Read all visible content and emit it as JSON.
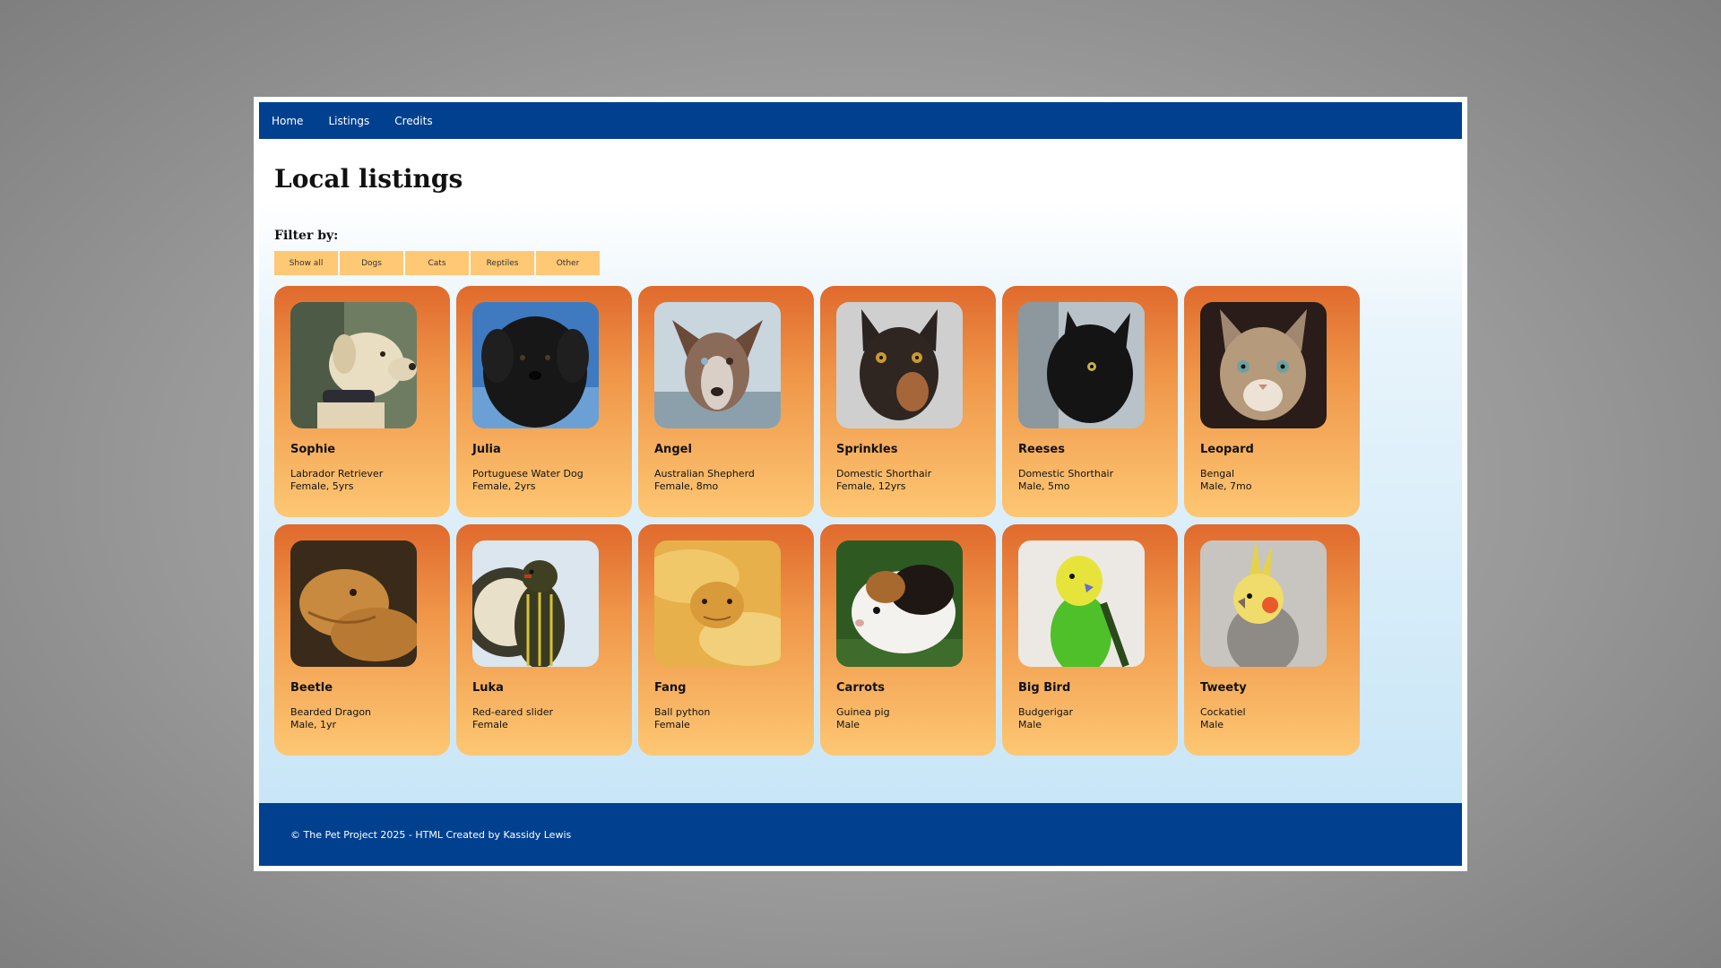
{
  "nav": {
    "items": [
      {
        "label": "Home"
      },
      {
        "label": "Listings"
      },
      {
        "label": "Credits"
      }
    ]
  },
  "page": {
    "title": "Local listings",
    "filter_label": "Filter by:"
  },
  "filters": [
    {
      "label": "Show all"
    },
    {
      "label": "Dogs"
    },
    {
      "label": "Cats"
    },
    {
      "label": "Reptiles"
    },
    {
      "label": "Other"
    }
  ],
  "pets": [
    {
      "name": "Sophie",
      "breed": "Labrador Retriever",
      "details": "Female, 5yrs",
      "photo": "dog-photo"
    },
    {
      "name": "Julia",
      "breed": "Portuguese Water Dog",
      "details": "Female, 2yrs",
      "photo": "dog-photo"
    },
    {
      "name": "Angel",
      "breed": "Australian Shepherd",
      "details": "Female, 8mo",
      "photo": "dog-photo"
    },
    {
      "name": "Sprinkles",
      "breed": "Domestic Shorthair",
      "details": "Female, 12yrs",
      "photo": "cat-photo"
    },
    {
      "name": "Reeses",
      "breed": "Domestic Shorthair",
      "details": "Male, 5mo",
      "photo": "cat-photo"
    },
    {
      "name": "Leopard",
      "breed": "Bengal",
      "details": "Male, 7mo",
      "photo": "cat-photo"
    },
    {
      "name": "Beetle",
      "breed": "Bearded Dragon",
      "details": "Male, 1yr",
      "photo": "lizard-photo"
    },
    {
      "name": "Luka",
      "breed": "Red-eared slider",
      "details": "Female",
      "photo": "turtle-photo"
    },
    {
      "name": "Fang",
      "breed": "Ball python",
      "details": "Female",
      "photo": "snake-photo"
    },
    {
      "name": "Carrots",
      "breed": "Guinea pig",
      "details": "Male",
      "photo": "guinea-pig-photo"
    },
    {
      "name": "Big Bird",
      "breed": "Budgerigar",
      "details": "Male",
      "photo": "parakeet-photo"
    },
    {
      "name": "Tweety",
      "breed": "Cockatiel",
      "details": "Male",
      "photo": "cockatiel-photo"
    }
  ],
  "footer": {
    "text": "© The Pet Project 2025 - HTML Created by Kassidy Lewis"
  },
  "colors": {
    "nav_background": "#00408f",
    "filter_button": "#ffc875",
    "card_top": "#e06a2d",
    "card_bottom": "#fdc773"
  }
}
